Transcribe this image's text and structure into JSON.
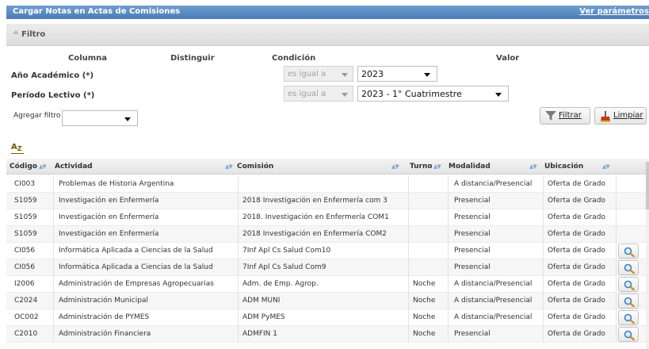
{
  "header": {
    "title": "Cargar Notas en Actas de Comisiones",
    "link": "Ver parámetros"
  },
  "filter": {
    "label": "Filtro",
    "columns": {
      "columna": "Columna",
      "distinguir": "Distinguir",
      "condicion": "Condición",
      "valor": "Valor"
    },
    "rows": [
      {
        "label": "Año Académico (*)",
        "condition": "es igual a",
        "value": "2023"
      },
      {
        "label": "Período Lectivo (*)",
        "condition": "es igual a",
        "value": "2023 - 1° Cuatrimestre"
      }
    ],
    "add_label": "Agregar filtro",
    "add_value": "",
    "filtrar_label": "Filtrar",
    "limpiar_label": "Limpiar"
  },
  "sort_icon": {
    "a": "A",
    "z": "Z"
  },
  "table": {
    "headers": {
      "codigo": "Código",
      "actividad": "Actividad",
      "comision": "Comisión",
      "turno": "Turno",
      "modalidad": "Modalidad",
      "ubicacion": "Ubicación"
    },
    "rows": [
      {
        "codigo": "CI003",
        "actividad": "Problemas de Historia Argentina",
        "comision": "",
        "turno": "",
        "modalidad": "A distancia/Presencial",
        "ubicacion": "Oferta de Grado",
        "action": false
      },
      {
        "codigo": "S1059",
        "actividad": "Investigación en Enfermería",
        "comision": "2018 Investigación en Enfermería com 3",
        "turno": "",
        "modalidad": "Presencial",
        "ubicacion": "Oferta de Grado",
        "action": false
      },
      {
        "codigo": "S1059",
        "actividad": "Investigación en Enfermería",
        "comision": "2018. Investigación en Enfermería COM1",
        "turno": "",
        "modalidad": "Presencial",
        "ubicacion": "Oferta de Grado",
        "action": false
      },
      {
        "codigo": "S1059",
        "actividad": "Investigación en Enfermería",
        "comision": "2018 Investigación en Enfermería COM2",
        "turno": "",
        "modalidad": "Presencial",
        "ubicacion": "Oferta de Grado",
        "action": false
      },
      {
        "codigo": "CI056",
        "actividad": "Informática Aplicada a Ciencias de la Salud",
        "comision": "7Inf Apl Cs Salud Com10",
        "turno": "",
        "modalidad": "Presencial",
        "ubicacion": "Oferta de Grado",
        "action": true
      },
      {
        "codigo": "CI056",
        "actividad": "Informática Aplicada a Ciencias de la Salud",
        "comision": "7Inf Apl Cs Salud Com9",
        "turno": "",
        "modalidad": "Presencial",
        "ubicacion": "Oferta de Grado",
        "action": true
      },
      {
        "codigo": "I2006",
        "actividad": "Administración de Empresas Agropecuarias",
        "comision": "Adm. de Emp. Agrop.",
        "turno": "Noche",
        "modalidad": "A distancia/Presencial",
        "ubicacion": "Oferta de Grado",
        "action": true
      },
      {
        "codigo": "C2024",
        "actividad": "Administración Municipal",
        "comision": "ADM MUNI",
        "turno": "Noche",
        "modalidad": "A distancia/Presencial",
        "ubicacion": "Oferta de Grado",
        "action": true
      },
      {
        "codigo": "OC002",
        "actividad": "Administración de PYMES",
        "comision": "ADM PyMES",
        "turno": "Noche",
        "modalidad": "A distancia/Presencial",
        "ubicacion": "Oferta de Grado",
        "action": true
      },
      {
        "codigo": "C2010",
        "actividad": "Administración Financiera",
        "comision": "ADMFIN 1",
        "turno": "Noche",
        "modalidad": "Presencial",
        "ubicacion": "Oferta de Grado",
        "action": true
      }
    ]
  },
  "colors": {
    "title_bar": "#4a7db5",
    "sort_arrow": "#8aa6c8",
    "filter_icon": "#7a7a7a",
    "limpiar_icon": "#c0392b"
  },
  "icons": {
    "filter": "funnel-icon",
    "limpiar": "broom-icon",
    "row_action": "magnifier-icon"
  }
}
